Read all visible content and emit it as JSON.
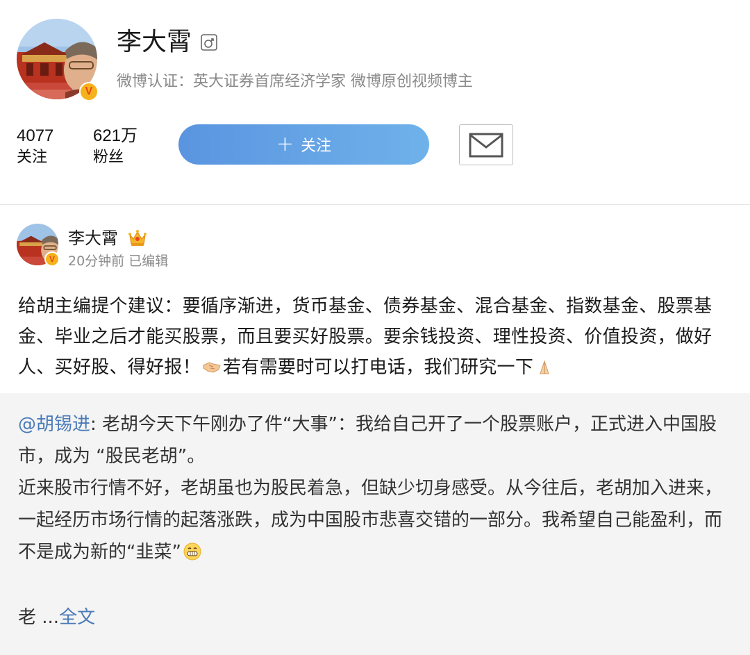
{
  "profile": {
    "name": "李大霄",
    "gender_icon": "male-icon",
    "certification": "微博认证：英大证券首席经济学家 微博原创视频博主",
    "verified_badge": "V",
    "stats": {
      "following_count": "4077",
      "following_label": "关注",
      "fans_count": "621万",
      "fans_label": "粉丝"
    },
    "follow_button": {
      "icon": "+",
      "label": "关注"
    },
    "message_button_icon": "mail-icon"
  },
  "post": {
    "author": "李大霄",
    "author_badge_icon": "crown-icon",
    "verified_badge": "V",
    "time": "20分钟前 已编辑",
    "text_part1": "给胡主编提个建议：要循序渐进，货币基金、债券基金、混合基金、指数基金、股票基金、毕业之后才能买股票，而且要买好股票。要余钱投资、理性投资、价值投资，做好人、买好股、得好报！",
    "text_part2": "若有需要时可以打电话，我们研究一下",
    "inline_icons": [
      "handshake-icon",
      "praying-hands-icon"
    ],
    "repost": {
      "mention": "@胡锡进",
      "text_line1": ": 老胡今天下午刚办了件“大事”：我给自己开了一个股票账户，正式进入中国股市，成为 “股民老胡”。",
      "text_line2": "近来股市行情不好，老胡虽也为股民着急，但缺少切身感受。从今往后，老胡加入进来，一起经历市场行情的起落涨跌，成为中国股市悲喜交错的一部分。我希望自己能盈利，而不是成为新的“韭菜”",
      "emoji_icon": "grin-emoji-icon",
      "truncated_prefix": "老 ...",
      "fulltext_link": "全文"
    }
  },
  "colors": {
    "accent_link": "#4a7ab8",
    "follow_gradient_start": "#5a94e0",
    "follow_gradient_end": "#6fb2ea",
    "badge_gold": "#f6b21b",
    "repost_bg": "#f4f4f4",
    "muted_text": "#8a8a8a"
  }
}
